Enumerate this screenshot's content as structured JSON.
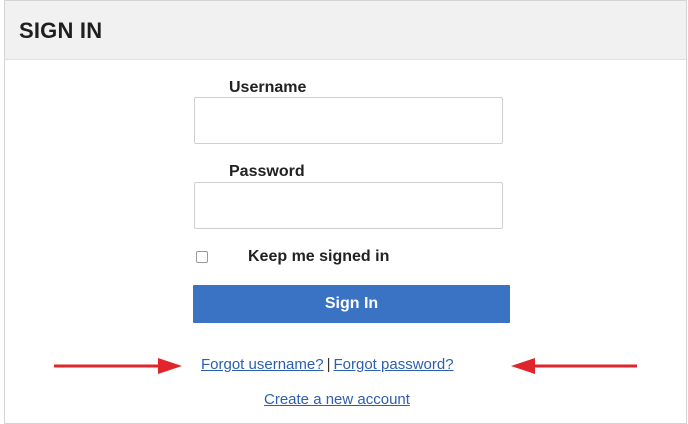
{
  "panel": {
    "title": "SIGN IN"
  },
  "form": {
    "username_label": "Username",
    "username_value": "",
    "password_label": "Password",
    "password_value": "",
    "keep_signed_in_label": "Keep me signed in",
    "keep_signed_in_checked": false,
    "signin_button_label": "Sign In"
  },
  "links": {
    "forgot_username": "Forgot username?",
    "separator": "|",
    "forgot_password": "Forgot password?",
    "create_account": "Create a new account"
  },
  "annotations": {
    "arrow_color": "#e0262a",
    "arrow_count": 2
  },
  "colors": {
    "primary_button": "#3a73c3",
    "link": "#2a5fb2",
    "header_background": "#f1f1f1"
  }
}
